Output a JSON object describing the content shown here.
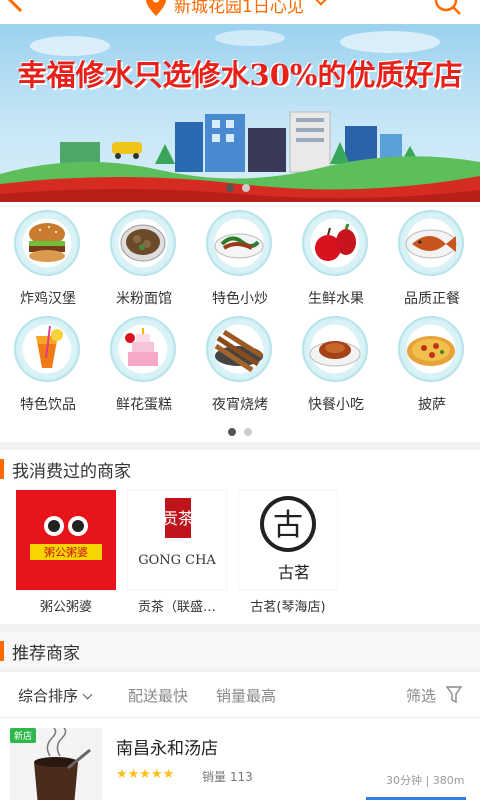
{
  "header": {
    "location": "新城花园1日心见",
    "accent": "#ff6a00"
  },
  "banner": {
    "title": "幸福修水只选修水30%的优质好店",
    "slide_count": 2,
    "active_slide": 1
  },
  "categories": {
    "items": [
      {
        "label": "炸鸡汉堡",
        "icon": "burger-icon"
      },
      {
        "label": "米粉面馆",
        "icon": "noodle-bowl-icon"
      },
      {
        "label": "特色小炒",
        "icon": "stir-fry-icon"
      },
      {
        "label": "生鲜水果",
        "icon": "fruit-icon"
      },
      {
        "label": "品质正餐",
        "icon": "fish-dish-icon"
      },
      {
        "label": "特色饮品",
        "icon": "drink-icon"
      },
      {
        "label": "鲜花蛋糕",
        "icon": "cake-icon"
      },
      {
        "label": "夜宵烧烤",
        "icon": "bbq-icon"
      },
      {
        "label": "快餐小吃",
        "icon": "fast-food-icon"
      },
      {
        "label": "披萨",
        "icon": "pizza-icon"
      }
    ],
    "page_count": 2,
    "active_page": 1
  },
  "visited": {
    "title": "我消费过的商家",
    "merchants": [
      {
        "name": "粥公粥婆",
        "logo_text": "粥公粥婆"
      },
      {
        "name": "贡茶（联盛…",
        "logo_text": "GONG CHA",
        "logo_sub": "贡茶"
      },
      {
        "name": "古茗(琴海店)",
        "logo_text": "古茗",
        "logo_mark": "古"
      }
    ]
  },
  "recommend": {
    "title": "推荐商家"
  },
  "sort": {
    "options": [
      "综合排序",
      "配送最快",
      "销量最高"
    ],
    "filter_label": "筛选"
  },
  "shops": [
    {
      "badge": "新店",
      "name": "南昌永和汤店",
      "rating": 4.5,
      "stars": "★★★★★",
      "sales_label": "销量 113",
      "meta": "30分钟 | 380m"
    }
  ]
}
